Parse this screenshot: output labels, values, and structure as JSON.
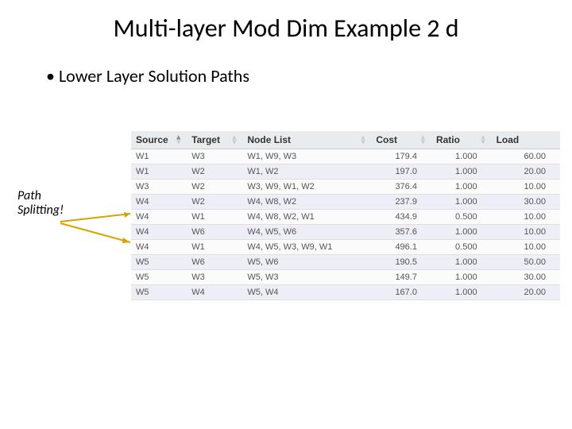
{
  "title": "Multi-layer Mod Dim Example 2 d",
  "bullet": "Lower Layer Solution Paths",
  "annotation_line1": "Path",
  "annotation_line2": "Splitting!",
  "table": {
    "headers": {
      "source": "Source",
      "target": "Target",
      "nodelist": "Node List",
      "cost": "Cost",
      "ratio": "Ratio",
      "load": "Load"
    },
    "rows": [
      {
        "source": "W1",
        "target": "W3",
        "nodelist": "W1, W9, W3",
        "cost": "179.4",
        "ratio": "1.000",
        "load": "60.00"
      },
      {
        "source": "W1",
        "target": "W2",
        "nodelist": "W1, W2",
        "cost": "197.0",
        "ratio": "1.000",
        "load": "20.00"
      },
      {
        "source": "W3",
        "target": "W2",
        "nodelist": "W3, W9, W1, W2",
        "cost": "376.4",
        "ratio": "1.000",
        "load": "10.00"
      },
      {
        "source": "W4",
        "target": "W2",
        "nodelist": "W4, W8, W2",
        "cost": "237.9",
        "ratio": "1.000",
        "load": "30.00"
      },
      {
        "source": "W4",
        "target": "W1",
        "nodelist": "W4, W8, W2, W1",
        "cost": "434.9",
        "ratio": "0.500",
        "load": "10.00"
      },
      {
        "source": "W4",
        "target": "W6",
        "nodelist": "W4, W5, W6",
        "cost": "357.6",
        "ratio": "1.000",
        "load": "10.00"
      },
      {
        "source": "W4",
        "target": "W1",
        "nodelist": "W4, W5, W3, W9, W1",
        "cost": "496.1",
        "ratio": "0.500",
        "load": "10.00"
      },
      {
        "source": "W5",
        "target": "W6",
        "nodelist": "W5, W6",
        "cost": "190.5",
        "ratio": "1.000",
        "load": "50.00"
      },
      {
        "source": "W5",
        "target": "W3",
        "nodelist": "W5, W3",
        "cost": "149.7",
        "ratio": "1.000",
        "load": "30.00"
      },
      {
        "source": "W5",
        "target": "W4",
        "nodelist": "W5, W4",
        "cost": "167.0",
        "ratio": "1.000",
        "load": "20.00"
      }
    ]
  }
}
